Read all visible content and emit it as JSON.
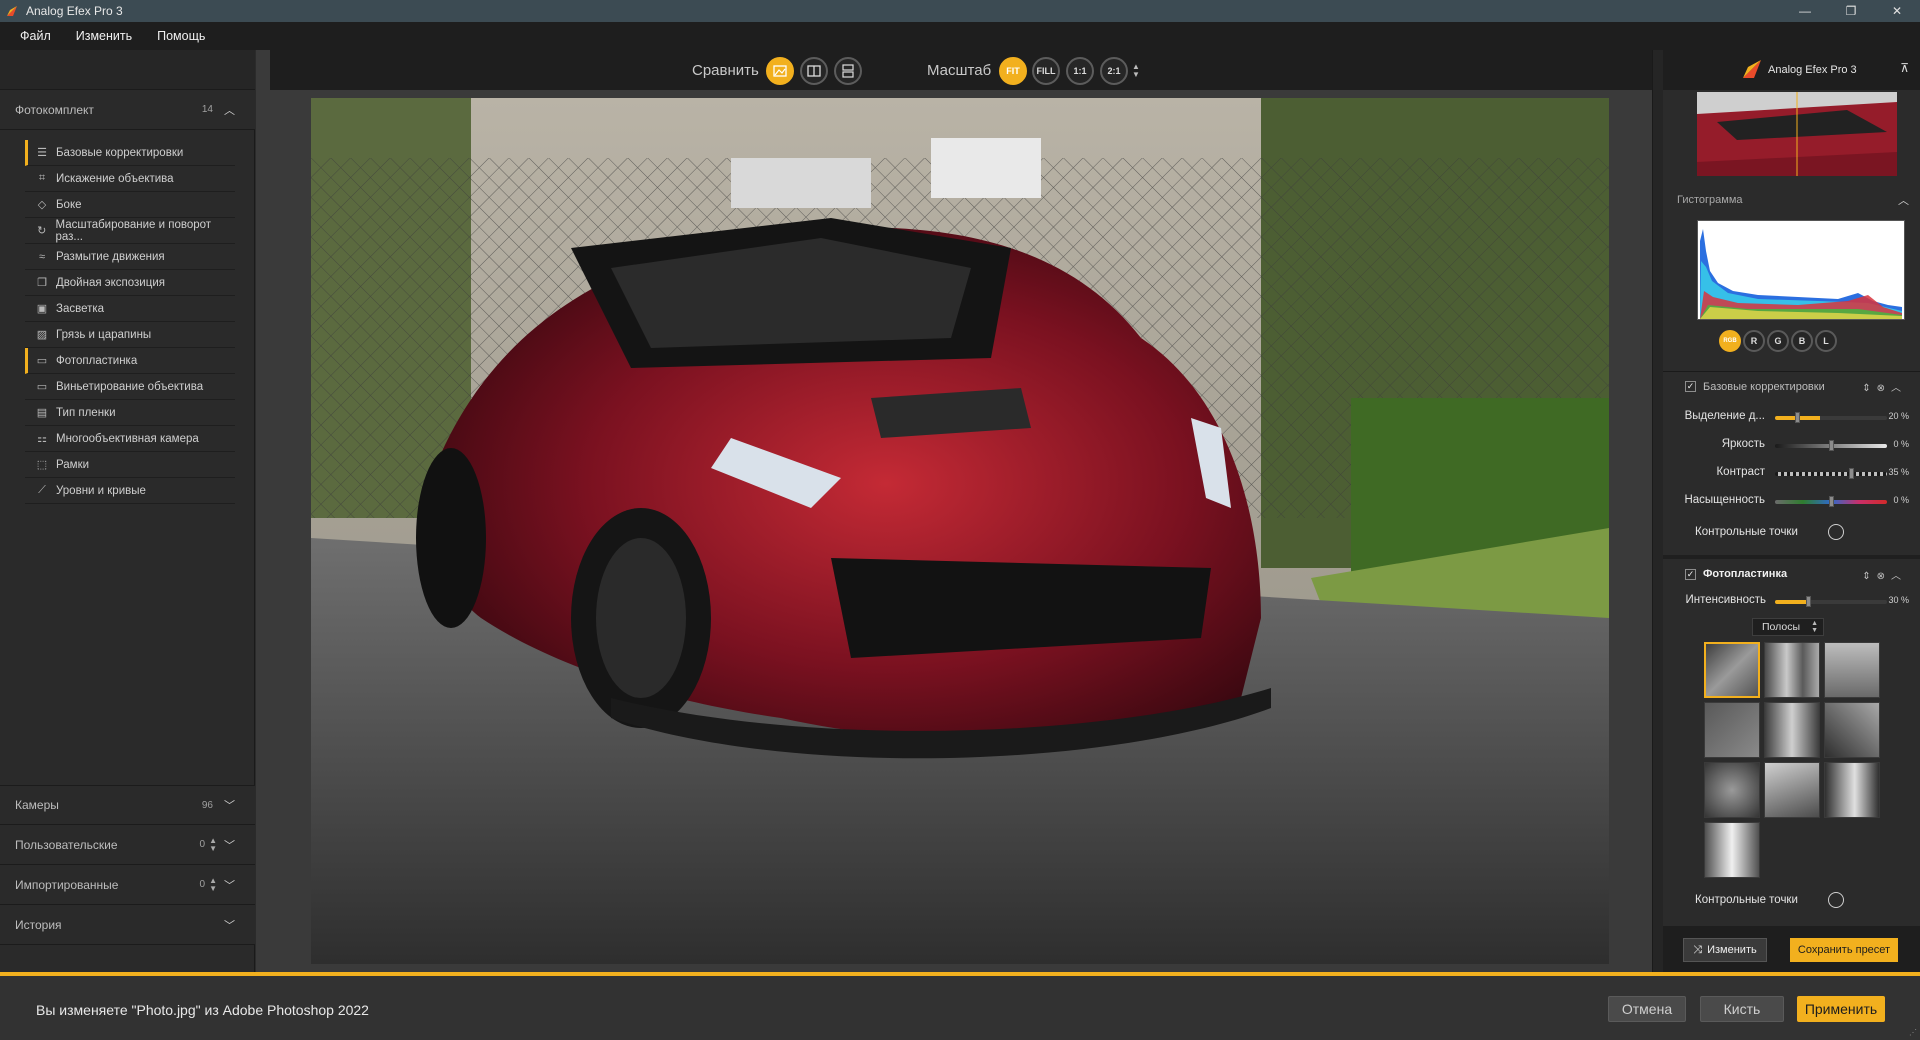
{
  "window": {
    "title": "Analog Efex Pro 3",
    "controls": {
      "minimize": "—",
      "restore": "❐",
      "close": "✕"
    }
  },
  "menu": [
    "Файл",
    "Изменить",
    "Помощь"
  ],
  "left_panel": {
    "presets": {
      "label": "Фотокомплект",
      "count": "14"
    },
    "filters": [
      {
        "label": "Базовые корректировки",
        "icon": "sliders-icon",
        "active": true
      },
      {
        "label": "Искажение объектива",
        "icon": "crop-icon",
        "active": false
      },
      {
        "label": "Боке",
        "icon": "bokeh-icon",
        "active": false
      },
      {
        "label": "Масштабирование и поворот раз...",
        "icon": "rotate-icon",
        "active": false
      },
      {
        "label": "Размытие движения",
        "icon": "motion-blur-icon",
        "active": false
      },
      {
        "label": "Двойная экспозиция",
        "icon": "double-exposure-icon",
        "active": false
      },
      {
        "label": "Засветка",
        "icon": "light-leak-icon",
        "active": false
      },
      {
        "label": "Грязь и царапины",
        "icon": "scratches-icon",
        "active": false
      },
      {
        "label": "Фотопластинка",
        "icon": "plate-icon",
        "active": true
      },
      {
        "label": "Виньетирование объектива",
        "icon": "vignette-icon",
        "active": false
      },
      {
        "label": "Тип пленки",
        "icon": "film-icon",
        "active": false
      },
      {
        "label": "Многообъективная камера",
        "icon": "multi-lens-icon",
        "active": false
      },
      {
        "label": "Рамки",
        "icon": "frames-icon",
        "active": false
      },
      {
        "label": "Уровни и кривые",
        "icon": "curves-icon",
        "active": false
      }
    ],
    "sections": [
      {
        "label": "Камеры",
        "count": "96"
      },
      {
        "label": "Пользовательские",
        "count": "0"
      },
      {
        "label": "Импортированные",
        "count": "0"
      },
      {
        "label": "История",
        "count": ""
      }
    ]
  },
  "toolbar": {
    "compare_label": "Сравнить",
    "zoom_label": "Масштаб",
    "zoom_buttons": [
      "FIT",
      "FILL",
      "1:1",
      "2:1"
    ]
  },
  "right_panel": {
    "brand": "Analog Efex Pro 3",
    "histogram_title": "Гистограмма",
    "channels": [
      "RGB",
      "R",
      "G",
      "B",
      "L"
    ],
    "basic": {
      "title": "Базовые корректировки",
      "sliders": [
        {
          "label": "Выделение д...",
          "value": "20 %",
          "level": 0.2
        },
        {
          "label": "Яркость",
          "value": "0 %",
          "level": 0.5
        },
        {
          "label": "Контраст",
          "value": "35 %",
          "level": 0.675
        },
        {
          "label": "Насыщенность",
          "value": "0 %",
          "level": 0.5
        }
      ],
      "control_points": "Контрольные точки"
    },
    "plate": {
      "title": "Фотопластинка",
      "intensity_label": "Интенсивность",
      "intensity_value": "30 %",
      "intensity_level": 0.3,
      "dropdown": "Полосы",
      "control_points": "Контрольные точки"
    },
    "buttons": {
      "change": "Изменить",
      "save": "Сохранить пресет"
    }
  },
  "bottom": {
    "message": "Вы изменяете \"Photo.jpg\" из Adobe Photoshop 2022",
    "cancel": "Отмена",
    "brush": "Кисть",
    "apply": "Применить"
  },
  "colors": {
    "accent": "#f2b01e",
    "titlebar": "#3c4b53"
  }
}
